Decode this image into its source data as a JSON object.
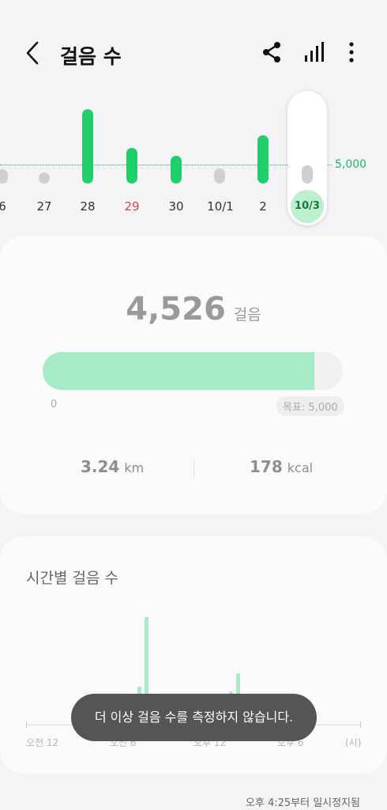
{
  "header": {
    "title": "걸음 수"
  },
  "icons": {
    "back": "back-arrow-icon",
    "share": "share-icon",
    "stats": "bar-signal-icon",
    "more": "more-vertical-icon"
  },
  "weekly_chart": {
    "goal_label": "5,000",
    "days": [
      {
        "label": "6",
        "color": "#333333"
      },
      {
        "label": "27",
        "color": "#333333"
      },
      {
        "label": "28",
        "color": "#333333"
      },
      {
        "label": "29",
        "color": "#d64545"
      },
      {
        "label": "30",
        "color": "#333333"
      },
      {
        "label": "10/1",
        "color": "#333333"
      },
      {
        "label": "2",
        "color": "#333333"
      }
    ],
    "selected_label": "10/3"
  },
  "summary": {
    "steps": "4,526",
    "steps_unit": "걸음",
    "progress_fraction": 0.905,
    "zero_label": "0",
    "goal_badge": "목표: 5,000",
    "distance": "3.24",
    "distance_unit": "km",
    "calories": "178",
    "calories_unit": "kcal"
  },
  "hourly": {
    "title": "시간별 걸음 수",
    "axis_labels": [
      "오전 12",
      "오전 6",
      "오후 12",
      "오후 6",
      "(시)"
    ]
  },
  "toast": "더 이상 걸음 수를 측정하지 않습니다.",
  "footer": "오후 4:25부터 일시정지됨",
  "colors": {
    "accent": "#1fb864",
    "bar_light": "#a7eac6",
    "sunday": "#d64545"
  }
}
